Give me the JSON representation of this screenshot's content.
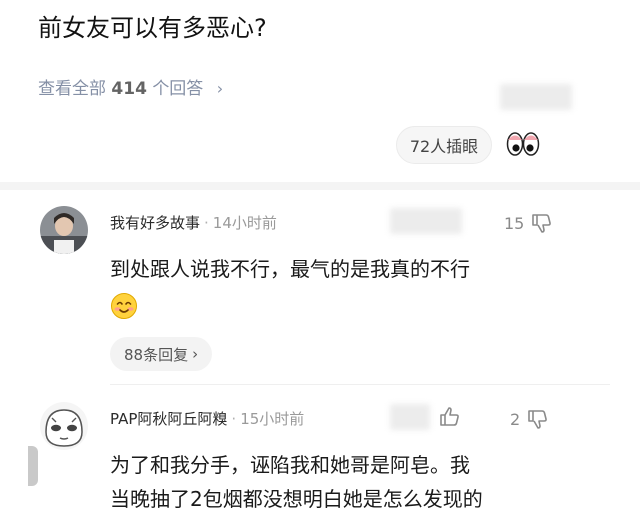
{
  "question": {
    "title": "前女友可以有多恶心?",
    "view_all_prefix": "查看全部",
    "answer_count": "414",
    "view_all_suffix": "个回答",
    "chevron": "›"
  },
  "reaction": {
    "label": "72人插眼",
    "icon": "eyes-icon"
  },
  "comments": [
    {
      "author": "我有好多故事",
      "separator": "·",
      "time": "14小时前",
      "likes": "15",
      "text_lines": [
        "到处跟人说我不行，最气的是我真的不行"
      ],
      "emoji": "smile-emoji-icon",
      "replies": "88条回复",
      "replies_chevron": "›"
    },
    {
      "author": "PAP阿秋阿丘阿糗",
      "separator": "·",
      "time": "15小时前",
      "likes": "2",
      "text_lines": [
        "为了和我分手，诬陷我和她哥是阿皂。我",
        "当晚抽了2包烟都没想明白她是怎么发现的"
      ]
    }
  ],
  "colors": {
    "meta": "#8590a6",
    "band": "#f4f4f4",
    "pill": "#f3f3f3"
  }
}
